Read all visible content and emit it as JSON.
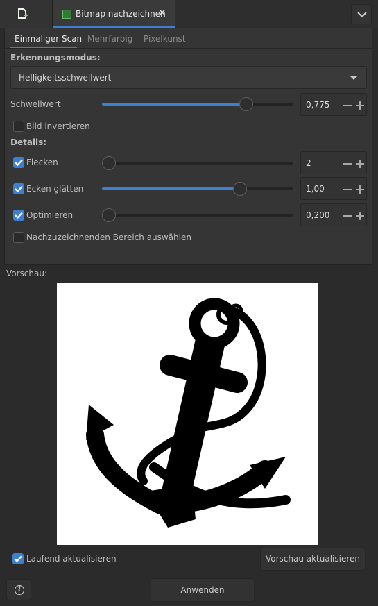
{
  "doc_tab": {
    "title": "Bitmap nachzeichnen",
    "close": "✕"
  },
  "subtabs": [
    "Einmaliger Scan",
    "Mehrfarbig",
    "Pixelkunst"
  ],
  "detection": {
    "heading": "Erkennungsmodus:",
    "selected": "Helligkeitsschwellwert"
  },
  "threshold": {
    "label": "Schwellwert",
    "value": "0,775",
    "level": 0.775
  },
  "invert": {
    "label": "Bild invertieren",
    "checked": false
  },
  "details": {
    "heading": "Details:",
    "speckles": {
      "label": "Flecken",
      "checked": true,
      "value": "2",
      "level": 0.0
    },
    "smooth": {
      "label": "Ecken glätten",
      "checked": true,
      "value": "1,00",
      "level": 0.74
    },
    "optimize": {
      "label": "Optimieren",
      "checked": true,
      "value": "0,200",
      "level": 0.0
    }
  },
  "select_area": {
    "label": "Nachzuzeichnenden Bereich auswählen",
    "checked": false
  },
  "preview": {
    "label": "Vorschau:"
  },
  "live_update": {
    "label": "Laufend aktualisieren",
    "checked": true
  },
  "buttons": {
    "update_preview": "Vorschau aktualisieren",
    "apply": "Anwenden"
  },
  "icons": {
    "new_document": "document-add-icon",
    "menu": "chevron-down-icon",
    "info": "info-icon",
    "tab": "bitmap-trace-icon"
  },
  "colors": {
    "accent": "#3d7fd1",
    "background": "#2b2b2b",
    "panel": "#353535"
  }
}
